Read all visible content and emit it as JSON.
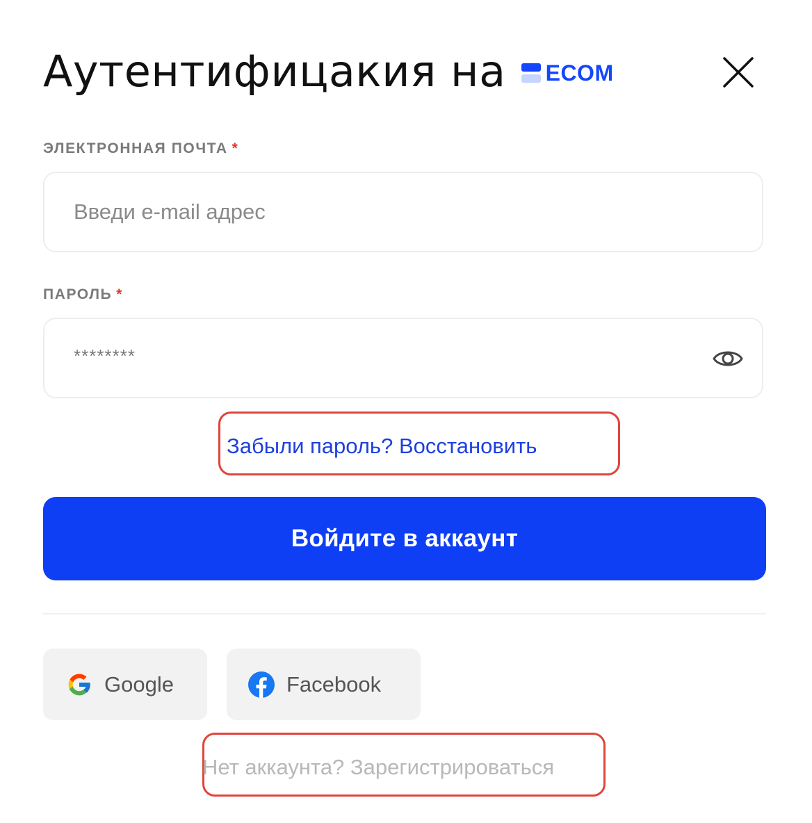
{
  "header": {
    "title": "Аутентифицакия на",
    "brand_name": "ECOM",
    "brand_color": "#1446ff",
    "close_icon": "close-icon"
  },
  "form": {
    "email": {
      "label": "ЭЛЕКТРОННАЯ ПОЧТА",
      "required_mark": "*",
      "placeholder": "Введи e-mail адрес",
      "value": ""
    },
    "password": {
      "label": "ПАРОЛЬ",
      "required_mark": "*",
      "masked_value": "********",
      "visibility_icon": "eye-icon"
    },
    "forgot_password_link": "Забыли пароль? Восстановить",
    "submit_label": "Войдите в аккаунт",
    "submit_color": "#0e3ff5"
  },
  "social": {
    "google_label": "Google",
    "facebook_label": "Facebook"
  },
  "footer": {
    "register_link": "Нет аккаунта? Зарегистрироваться"
  },
  "annotations": {
    "highlight_color": "#e0443a"
  }
}
